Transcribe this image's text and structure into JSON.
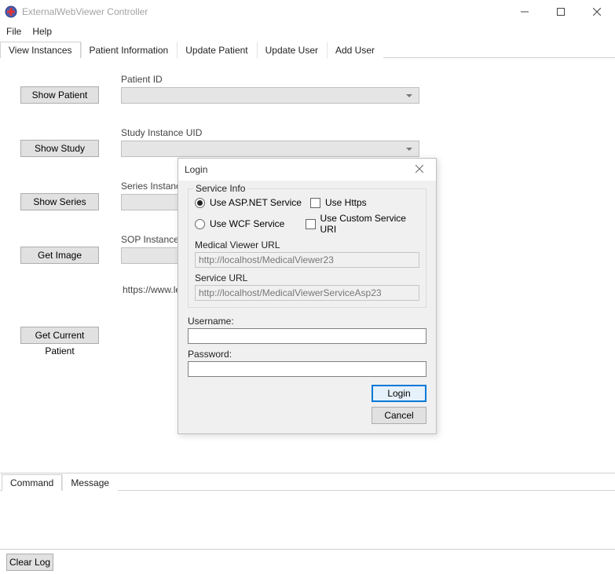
{
  "window": {
    "title": "ExternalWebViewer Controller"
  },
  "menu": {
    "file": "File",
    "help": "Help"
  },
  "tabs": {
    "view_instances": "View Instances",
    "patient_information": "Patient Information",
    "update_patient": "Update Patient",
    "update_user": "Update User",
    "add_user": "Add User"
  },
  "view": {
    "show_patient": "Show Patient",
    "patient_id": "Patient ID",
    "show_study": "Show Study",
    "study_uid": "Study Instance UID",
    "show_series": "Show Series",
    "series_uid": "Series Instance UID",
    "get_image": "Get Image",
    "sop_uid": "SOP Instance UID",
    "url_prefix": "https://www.le",
    "get_current_patient": "Get Current Patient"
  },
  "bottom": {
    "command": "Command",
    "message": "Message",
    "clear_log": "Clear Log"
  },
  "login": {
    "title": "Login",
    "service_info": "Service Info",
    "use_asp": "Use ASP.NET Service",
    "use_wcf": "Use WCF Service",
    "use_https": "Use Https",
    "use_custom": "Use Custom Service URI",
    "med_url_lbl": "Medical Viewer URL",
    "med_url_val": "http://localhost/MedicalViewer23",
    "svc_url_lbl": "Service URL",
    "svc_url_val": "http://localhost/MedicalViewerServiceAsp23",
    "username": "Username:",
    "password": "Password:",
    "login": "Login",
    "cancel": "Cancel"
  }
}
